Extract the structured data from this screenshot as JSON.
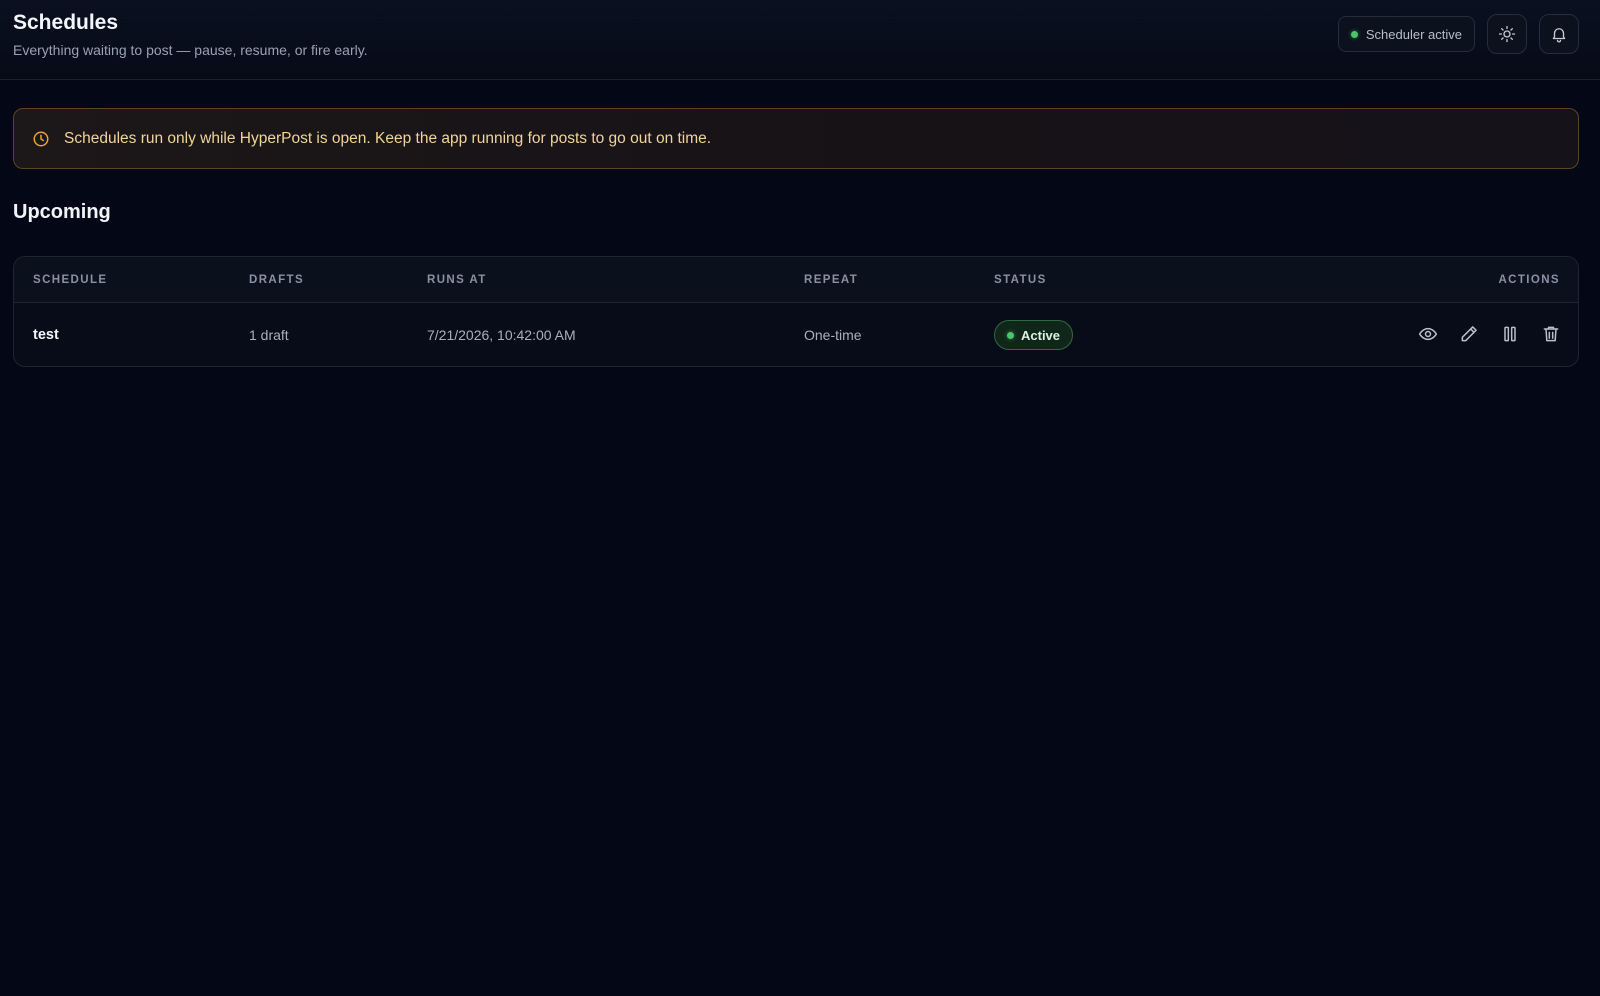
{
  "header": {
    "title": "Schedules",
    "subtitle": "Everything waiting to post — pause, resume, or fire early.",
    "status_label": "Scheduler active",
    "status_color": "#4cc46a",
    "theme_icon": "sun-icon",
    "notifications_icon": "bell-icon"
  },
  "banner": {
    "icon": "clock-icon",
    "text": "Schedules run only while HyperPost is open. Keep the app running for posts to go out on time.",
    "accent_color": "#e6a23c"
  },
  "section": {
    "title": "Upcoming"
  },
  "table": {
    "columns": [
      "SCHEDULE",
      "DRAFTS",
      "RUNS AT",
      "REPEAT",
      "STATUS",
      "ACTIONS"
    ],
    "rows": [
      {
        "schedule": "test",
        "drafts": "1 draft",
        "runs_at": "7/21/2026, 10:42:00 AM",
        "repeat": "One-time",
        "status": "Active",
        "status_color": "#4cc46a",
        "actions": [
          "eye-icon",
          "pencil-icon",
          "pause-icon",
          "trash-icon"
        ]
      }
    ]
  }
}
